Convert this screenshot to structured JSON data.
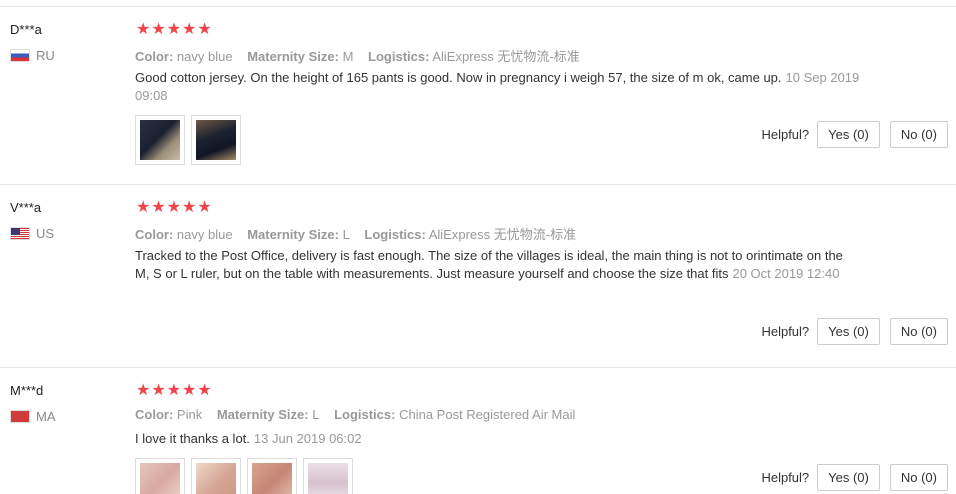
{
  "reviews": [
    {
      "user": "D***a",
      "country": "RU",
      "stars": "★★★★★",
      "color_label": "Color:",
      "color": "navy blue",
      "size_label": "Maternity Size:",
      "size": "M",
      "logistics_label": "Logistics:",
      "logistics": "AliExpress 无忧物流-标准",
      "text": "Good cotton jersey. On the height of 165 pants is good. Now in pregnancy i weigh 57, the size of m ok, came up.",
      "date": "10 Sep 2019 09:08",
      "helpful_label": "Helpful?",
      "yes": "Yes (0)",
      "no": "No (0)"
    },
    {
      "user": "V***a",
      "country": "US",
      "stars": "★★★★★",
      "color_label": "Color:",
      "color": "navy blue",
      "size_label": "Maternity Size:",
      "size": "L",
      "logistics_label": "Logistics:",
      "logistics": "AliExpress 无忧物流-标准",
      "text": "Tracked to the Post Office, delivery is fast enough. The size of the villages is ideal, the main thing is not to orintimate on the M, S or L ruler, but on the table with measurements. Just measure yourself and choose the size that fits",
      "date": "20 Oct 2019 12:40",
      "helpful_label": "Helpful?",
      "yes": "Yes (0)",
      "no": "No (0)"
    },
    {
      "user": "M***d",
      "country": "MA",
      "stars": "★★★★★",
      "color_label": "Color:",
      "color": "Pink",
      "size_label": "Maternity Size:",
      "size": "L",
      "logistics_label": "Logistics:",
      "logistics": "China Post Registered Air Mail",
      "text": "I love it thanks a lot.",
      "date": "13 Jun 2019 06:02",
      "helpful_label": "Helpful?",
      "yes": "Yes (0)",
      "no": "No (0)"
    }
  ],
  "colors": {
    "star": "#f0454b",
    "muted": "#999999",
    "border": "#e8e8e8"
  },
  "rating": 5
}
